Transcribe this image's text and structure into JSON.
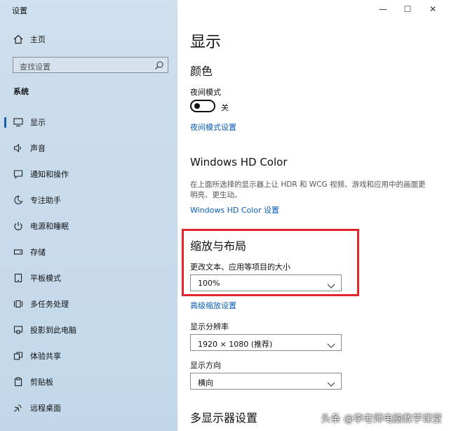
{
  "window": {
    "title": "设置"
  },
  "caption": {
    "minimize": "—",
    "maximize": "☐",
    "close": "✕"
  },
  "sidebar": {
    "home": "主页",
    "search_placeholder": "查找设置",
    "section": "系统",
    "items": [
      {
        "label": "显示",
        "icon": "monitor-icon",
        "selected": true
      },
      {
        "label": "声音",
        "icon": "speaker-icon"
      },
      {
        "label": "通知和操作",
        "icon": "notification-icon"
      },
      {
        "label": "专注助手",
        "icon": "moon-icon"
      },
      {
        "label": "电源和睡眠",
        "icon": "power-icon"
      },
      {
        "label": "存储",
        "icon": "storage-icon"
      },
      {
        "label": "平板模式",
        "icon": "tablet-icon"
      },
      {
        "label": "多任务处理",
        "icon": "multitask-icon"
      },
      {
        "label": "投影到此电脑",
        "icon": "project-icon"
      },
      {
        "label": "体验共享",
        "icon": "share-icon"
      },
      {
        "label": "剪贴板",
        "icon": "clipboard-icon"
      },
      {
        "label": "远程桌面",
        "icon": "remote-desktop-icon"
      }
    ]
  },
  "main": {
    "title": "显示",
    "color": {
      "heading": "颜色",
      "night_light_label": "夜间模式",
      "night_light_state": "关",
      "night_light_settings_link": "夜间模式设置"
    },
    "hdr": {
      "heading": "Windows HD Color",
      "description": "在上面所选择的显示器上让 HDR 和 WCG 视频、游戏和应用中的画面更明亮、更生动。",
      "link": "Windows HD Color 设置"
    },
    "scale": {
      "heading": "缩放与布局",
      "size_label": "更改文本、应用等项目的大小",
      "size_value": "100%",
      "advanced_link": "高级缩放设置",
      "resolution_label": "显示分辨率",
      "resolution_value": "1920 × 1080 (推荐)",
      "orientation_label": "显示方向",
      "orientation_value": "横向"
    },
    "multi_display": {
      "heading": "多显示器设置"
    }
  },
  "watermark": {
    "text": "头条 @李老师电脑教学课堂"
  },
  "colors": {
    "accent": "#0a5eb8",
    "highlight": "#e4262c",
    "selection_marker": "#1a5fb4"
  }
}
